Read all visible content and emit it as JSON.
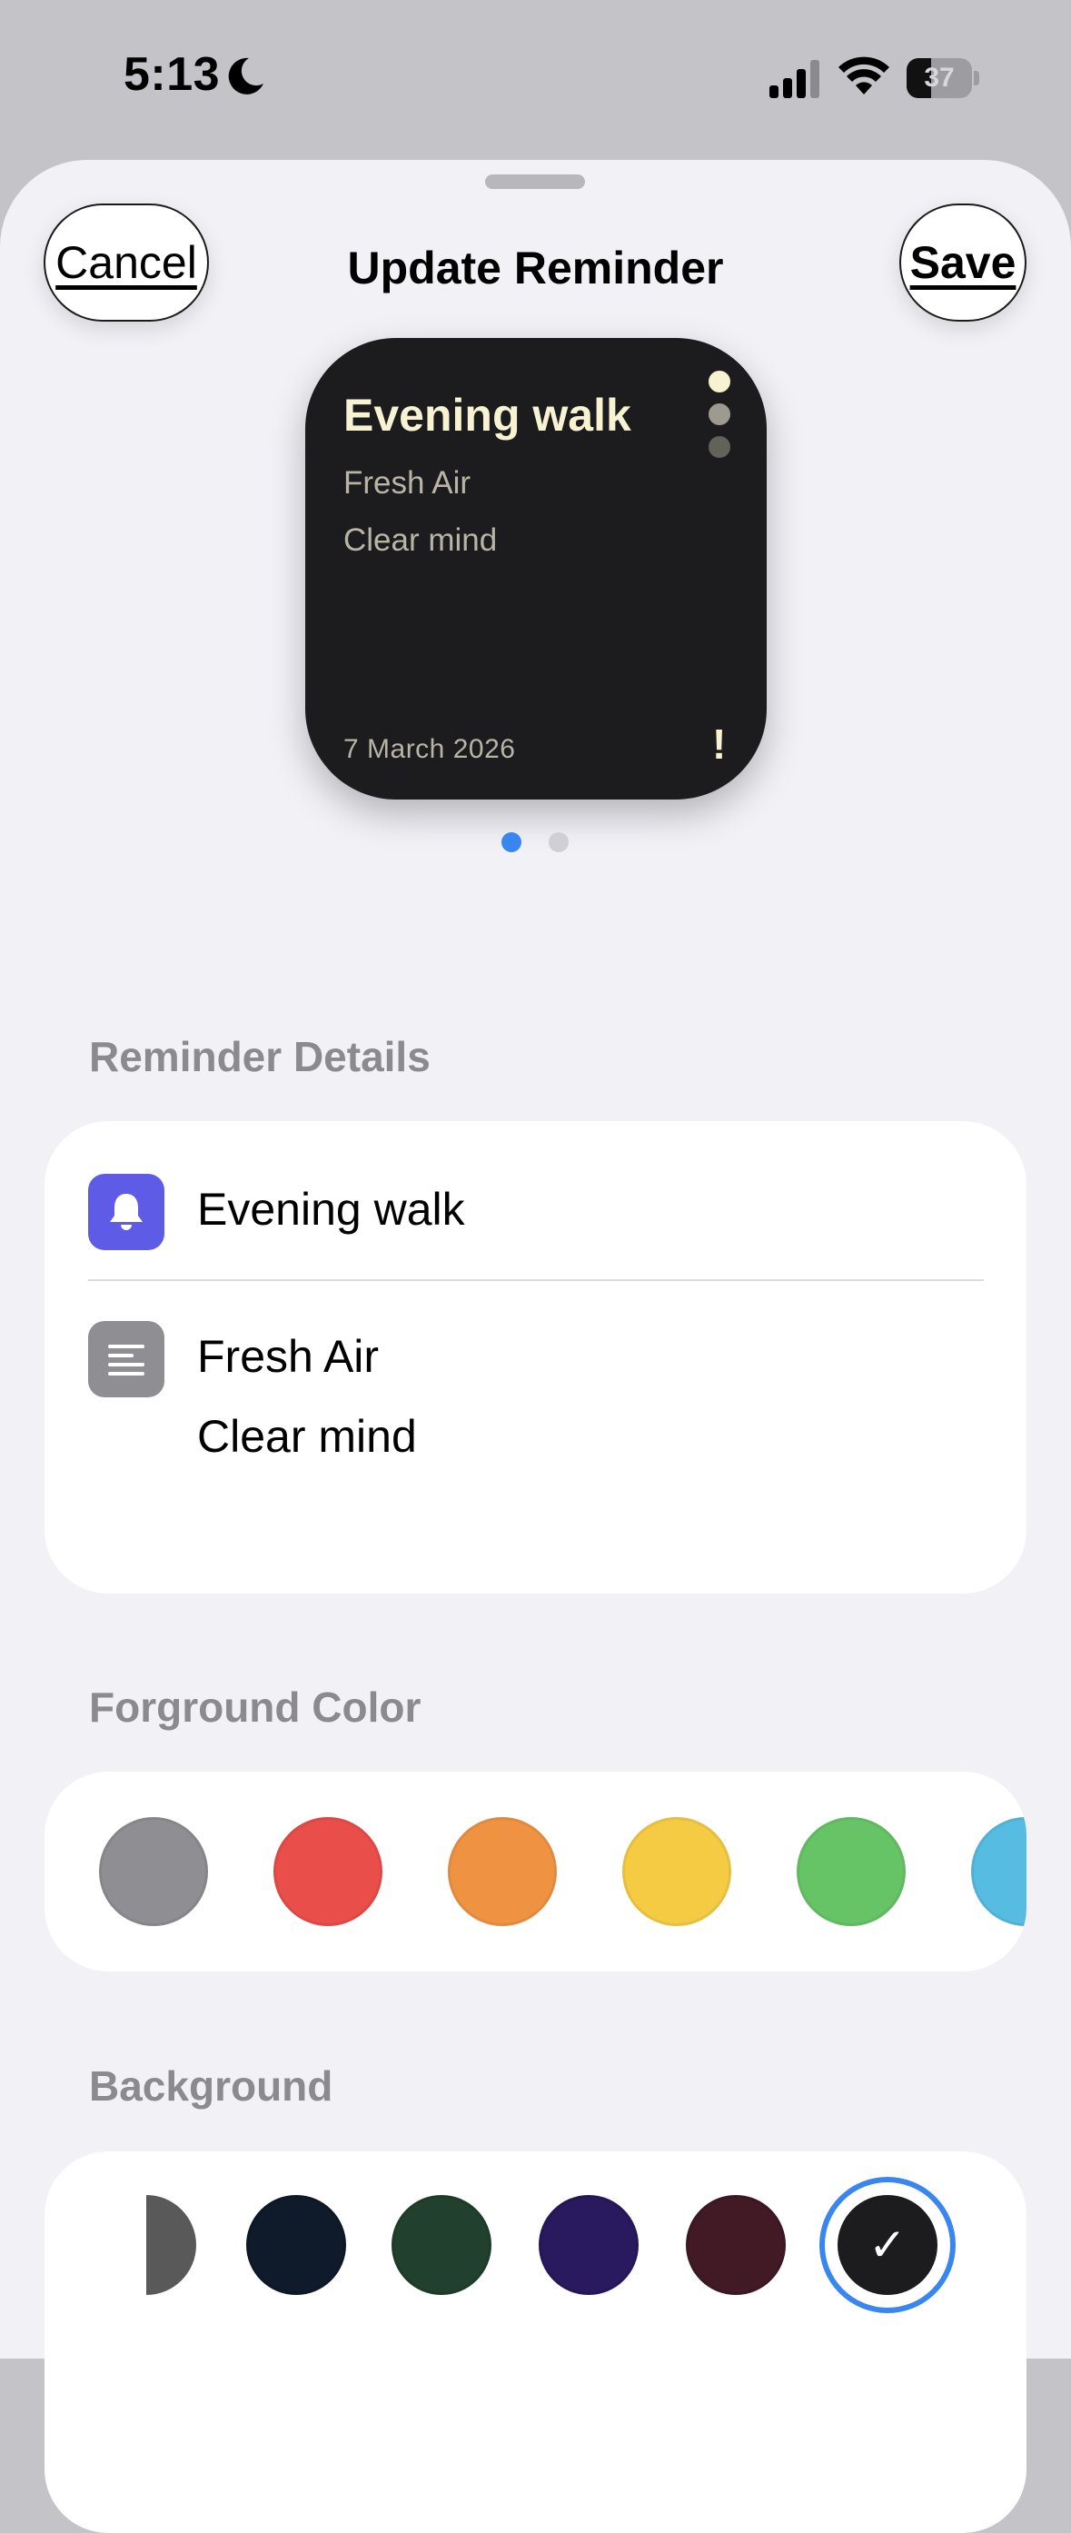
{
  "status_bar": {
    "time": "5:13",
    "battery_percent": "37",
    "battery_level": 0.37
  },
  "header": {
    "cancel_label": "Cancel",
    "title": "Update Reminder",
    "save_label": "Save"
  },
  "preview": {
    "title": "Evening walk",
    "lines": [
      "Fresh Air",
      "Clear mind"
    ],
    "date": "7 March 2026",
    "priority_mark": "!"
  },
  "pager": {
    "count": 2,
    "active": 1
  },
  "details": {
    "section_title": "Reminder Details",
    "title": "Evening walk",
    "notes": [
      "Fresh Air",
      "Clear mind"
    ]
  },
  "foreground": {
    "section_title": "Forground Color",
    "colors": [
      "#8e8e93",
      "#ea4e4a",
      "#ef9343",
      "#f5cb44",
      "#66c466",
      "#57bce2"
    ]
  },
  "background": {
    "section_title": "Background",
    "colors": [
      "#595959",
      "#0f1b2b",
      "#21402e",
      "#29195e",
      "#411a26",
      "#1c1c1e"
    ],
    "selected_index": 5,
    "check": "✓"
  },
  "icons": {
    "status": [
      "moon-icon",
      "signal-icon",
      "wifi-icon",
      "battery-icon"
    ],
    "rows": [
      "bell-icon",
      "notes-icon"
    ]
  }
}
